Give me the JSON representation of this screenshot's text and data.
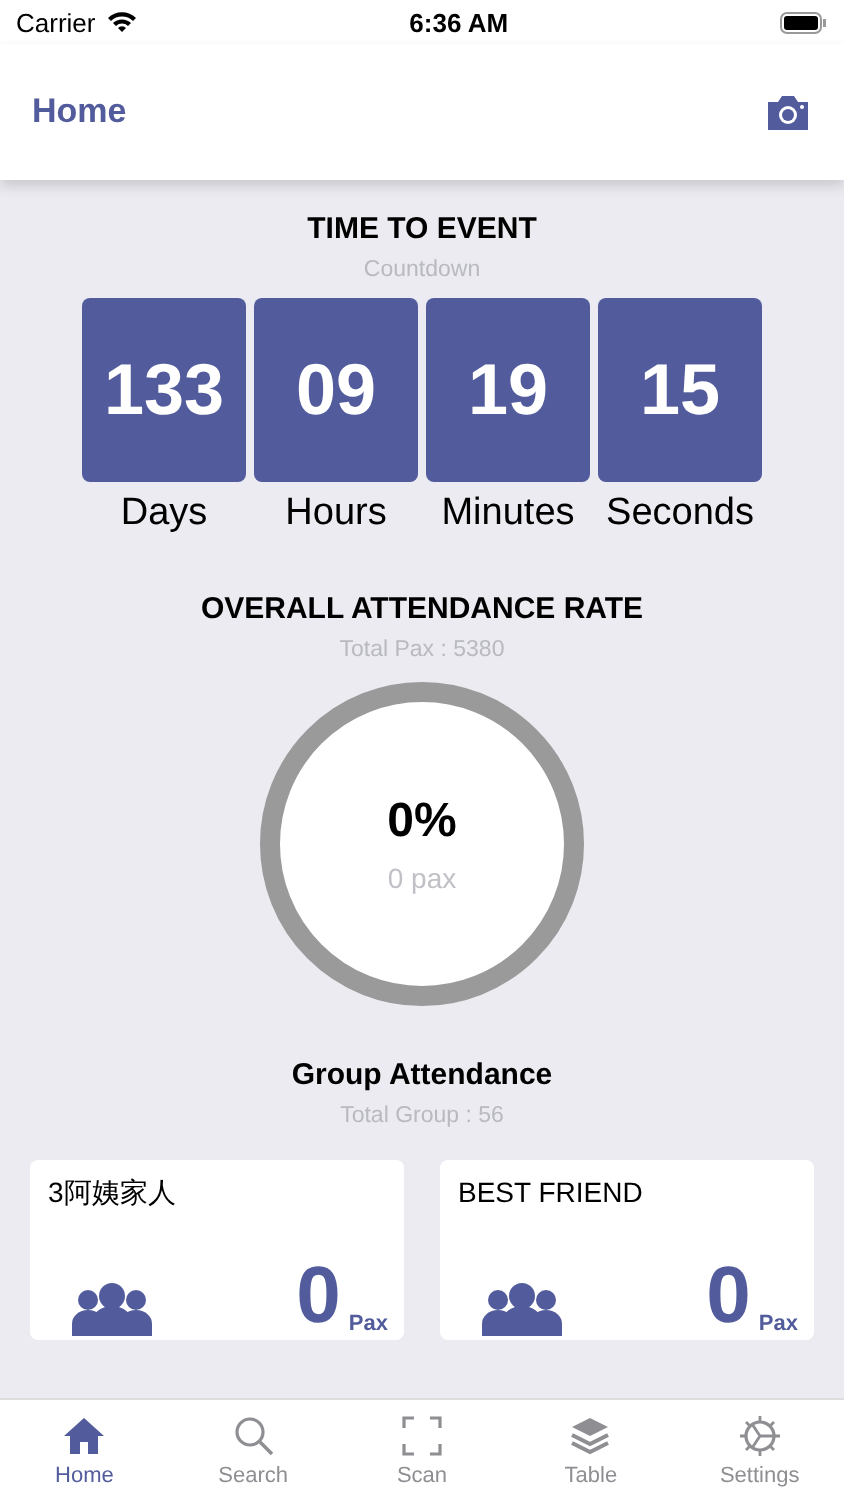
{
  "status_bar": {
    "carrier": "Carrier",
    "time": "6:36 AM"
  },
  "nav_bar": {
    "title": "Home"
  },
  "countdown": {
    "title": "TIME TO EVENT",
    "subtitle": "Countdown",
    "units": [
      {
        "value": "133",
        "label": "Days"
      },
      {
        "value": "09",
        "label": "Hours"
      },
      {
        "value": "19",
        "label": "Minutes"
      },
      {
        "value": "15",
        "label": "Seconds"
      }
    ]
  },
  "attendance": {
    "title": "OVERALL ATTENDANCE RATE",
    "subtitle": "Total Pax : 5380",
    "percent": "0%",
    "pax": "0 pax",
    "level": 0
  },
  "groups": {
    "title": "Group Attendance",
    "subtitle": "Total Group : 56",
    "items": [
      {
        "name": "3阿姨家人",
        "count": "0",
        "unit": "Pax"
      },
      {
        "name": "BEST FRIEND",
        "count": "0",
        "unit": "Pax"
      }
    ]
  },
  "tab_bar": [
    {
      "label": "Home",
      "kind": "home",
      "selected": true
    },
    {
      "label": "Search",
      "kind": "search",
      "selected": false
    },
    {
      "label": "Scan",
      "kind": "scan",
      "selected": false
    },
    {
      "label": "Table",
      "kind": "table",
      "selected": false
    },
    {
      "label": "Settings",
      "kind": "settings",
      "selected": false
    }
  ]
}
